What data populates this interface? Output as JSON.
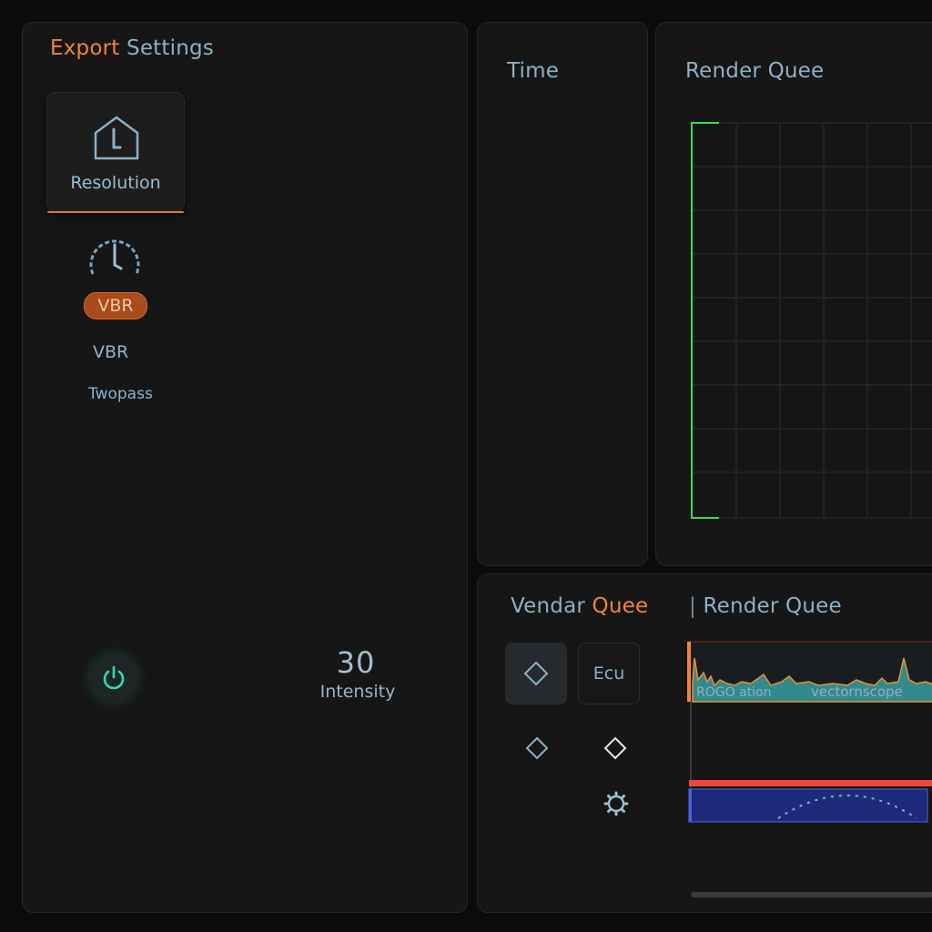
{
  "left_panel": {
    "title_part1": "Export",
    "title_part2": "Settings",
    "resolution_label": "Resolution",
    "vbr_pill": "VBR",
    "vbr_text": "VBR",
    "twopass_text": "Twopass",
    "intensity_value": "30",
    "intensity_label": "Intensity"
  },
  "time_panel": {
    "title": "Time"
  },
  "render_panel": {
    "title": "Render Quee"
  },
  "bottom_panel": {
    "title_part1": "Vendar",
    "title_part2": "Quee",
    "render_title": "Render Quee",
    "ecu_label": "Ecu",
    "wave_label1": "ROGO ation",
    "wave_label2": "vectornscope"
  },
  "colors": {
    "accent": "#f0843a",
    "text": "#8fb0c4",
    "power": "#39d7b4",
    "grid_green": "#3ddc4f",
    "waveform": "#3aa6a6",
    "red_bar": "#f04a3a",
    "blue_bar": "#1e2b7a"
  }
}
